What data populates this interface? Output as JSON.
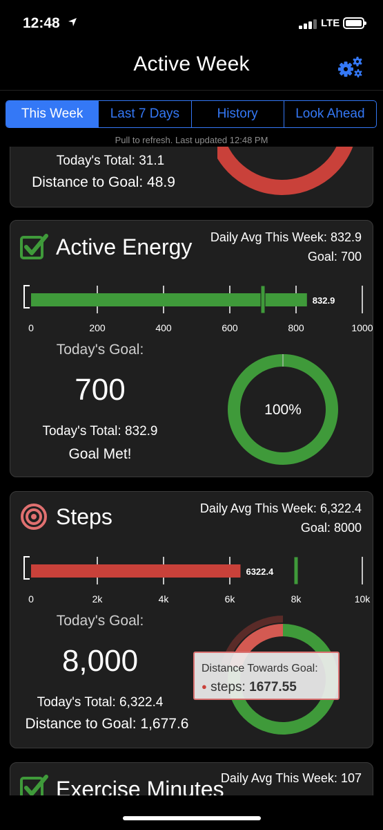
{
  "status": {
    "time": "12:48",
    "network": "LTE"
  },
  "nav": {
    "title": "Active Week"
  },
  "tabs": [
    {
      "label": "This Week",
      "active": true
    },
    {
      "label": "Last 7 Days",
      "active": false
    },
    {
      "label": "History",
      "active": false
    },
    {
      "label": "Look Ahead",
      "active": false
    }
  ],
  "refresh_text": "Pull to refresh.  Last updated 12:48 PM",
  "partial_card": {
    "total_label": "Today's Total:",
    "total_value": "31.1",
    "distance_label": "Distance to Goal:",
    "distance_value": "48.9",
    "progress_fraction": 0.39
  },
  "active_energy": {
    "title": "Active Energy",
    "avg_label": "Daily Avg This Week:",
    "avg_value": "832.9",
    "goal_label": "Goal:",
    "goal_value": "700",
    "bar_value": 832.9,
    "bar_value_label": "832.9",
    "goal_marker": 700,
    "axis_max": 1000,
    "ticks": [
      "0",
      "200",
      "400",
      "600",
      "800",
      "1000"
    ],
    "todays_goal_label": "Today's Goal:",
    "todays_goal_value": "700",
    "total_label": "Today's Total:",
    "total_value": "832.9",
    "status": "Goal Met!",
    "ring_percent": "100%",
    "ring_fraction": 1.0
  },
  "steps": {
    "title": "Steps",
    "avg_label": "Daily Avg This Week:",
    "avg_value": "6,322.4",
    "goal_label": "Goal:",
    "goal_value": "8000",
    "bar_value": 6322.4,
    "bar_value_label": "6322.4",
    "goal_marker": 8000,
    "axis_max": 10000,
    "ticks": [
      "0",
      "2k",
      "4k",
      "6k",
      "8k",
      "10k"
    ],
    "todays_goal_label": "Today's Goal:",
    "todays_goal_value": "8,000",
    "total_label": "Today's Total:",
    "total_value": "6,322.4",
    "distance_label": "Distance to Goal:",
    "distance_value": "1,677.6",
    "ring_fraction": 0.79,
    "tooltip": {
      "title": "Distance Towards Goal:",
      "series": "steps:",
      "value": "1677.55"
    }
  },
  "exercise": {
    "title": "Exercise Minutes",
    "avg_label": "Daily Avg This Week:",
    "avg_value": "107"
  },
  "colors": {
    "accent": "#3478f6",
    "green": "#3f9a3a",
    "red": "#c9413a",
    "card": "#1f1f1f"
  }
}
